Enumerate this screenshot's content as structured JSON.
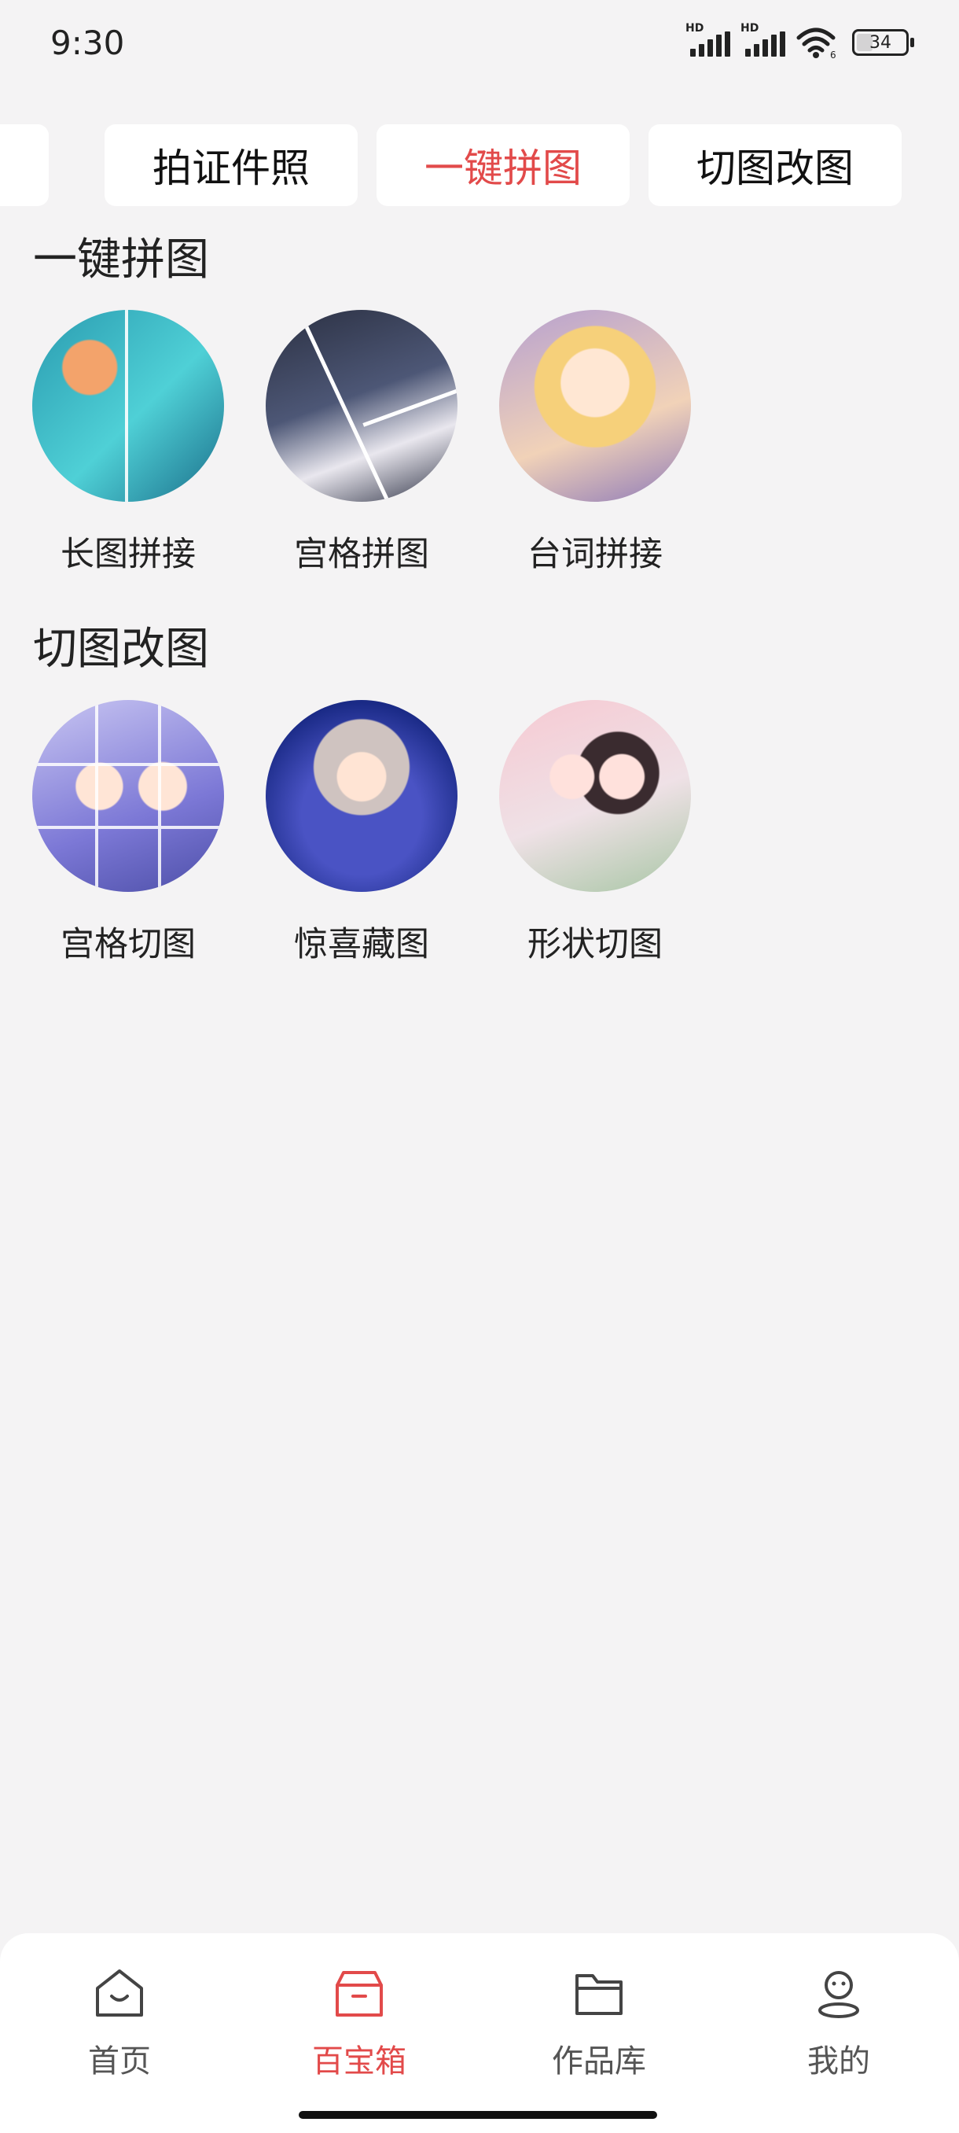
{
  "status_bar": {
    "time": "9:30",
    "battery": "34",
    "hd1": "HD",
    "hd2": "HD",
    "wifi_sub": "6"
  },
  "tabs": [
    {
      "label": ""
    },
    {
      "label": "拍证件照"
    },
    {
      "label": "一键拼图"
    },
    {
      "label": "切图改图"
    }
  ],
  "active_tab": "一键拼图",
  "sections": [
    {
      "title": "一键拼图",
      "items": [
        {
          "label": "长图拼接"
        },
        {
          "label": "宫格拼图"
        },
        {
          "label": "台词拼接"
        }
      ]
    },
    {
      "title": "切图改图",
      "items": [
        {
          "label": "宫格切图"
        },
        {
          "label": "惊喜藏图"
        },
        {
          "label": "形状切图"
        }
      ]
    }
  ],
  "bottom_nav": [
    {
      "label": "首页",
      "icon": "home-icon"
    },
    {
      "label": "百宝箱",
      "icon": "toolbox-icon"
    },
    {
      "label": "作品库",
      "icon": "folder-icon"
    },
    {
      "label": "我的",
      "icon": "profile-icon"
    }
  ],
  "accent_color": "#e24a4a",
  "background_color": "#f4f3f4"
}
